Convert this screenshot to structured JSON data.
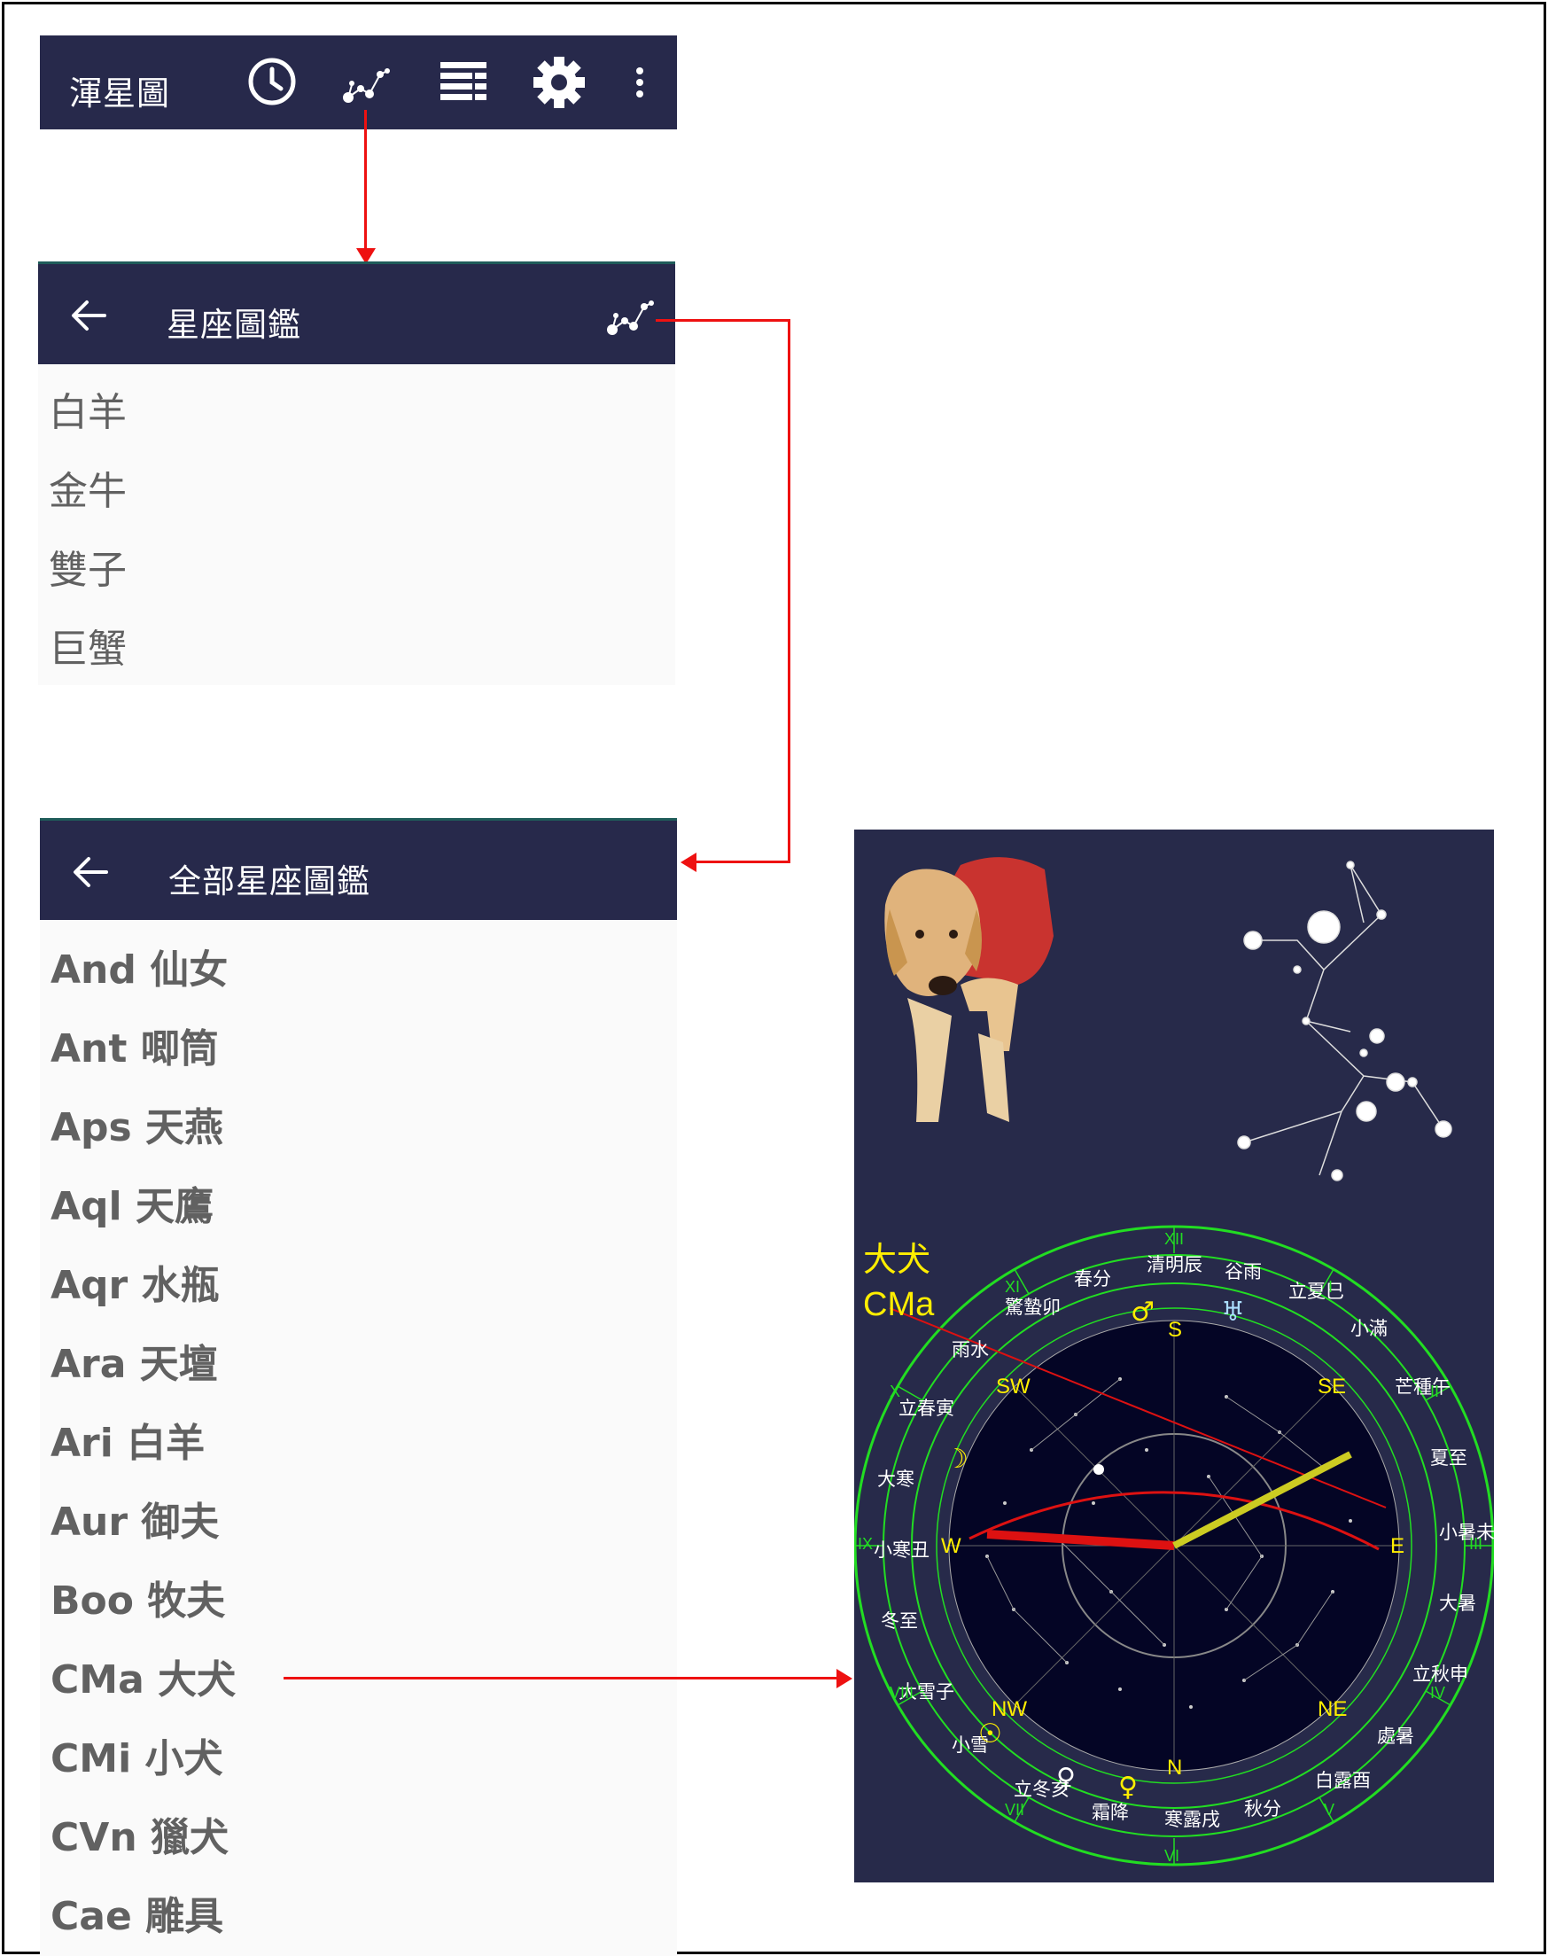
{
  "app_bar": {
    "title": "渾星圖",
    "icons": [
      "clock-icon",
      "constellation-icon",
      "list-icon",
      "gear-icon",
      "more-vert-icon"
    ]
  },
  "zodiac_screen": {
    "title": "星座圖鑑",
    "items": [
      "白羊",
      "金牛",
      "雙子",
      "巨蟹"
    ]
  },
  "all_screen": {
    "title": "全部星座圖鑑",
    "items": [
      "And 仙女",
      "Ant 唧筒",
      "Aps 天燕",
      "Aql 天鷹",
      "Aqr 水瓶",
      "Ara 天壇",
      "Ari 白羊",
      "Aur 御夫",
      "Boo 牧夫",
      "CMa 大犬",
      "CMi 小犬",
      "CVn 獵犬",
      "Cae 雕具"
    ]
  },
  "chart_view": {
    "label_zh": "大犬",
    "label_abbr": "CMa",
    "compass": [
      "S",
      "SW",
      "SE",
      "W",
      "E",
      "NW",
      "NE",
      "N"
    ],
    "solar_terms": [
      "春分",
      "清明辰",
      "谷雨",
      "立夏巳",
      "小滿",
      "芒種午",
      "夏至",
      "小暑未",
      "大暑",
      "立秋申",
      "處暑",
      "白露酉",
      "秋分",
      "寒露戌",
      "霜降",
      "立冬亥",
      "小雪",
      "大雪子",
      "冬至",
      "小寒丑",
      "大寒",
      "立春寅",
      "雨水",
      "驚蟄卯"
    ],
    "roman_hours": [
      "XII",
      "I",
      "II",
      "III",
      "IV",
      "V",
      "VI",
      "VII",
      "VIII",
      "IX",
      "X",
      "XI"
    ],
    "colors": {
      "bar": "#27294b",
      "panel": "#272a4a",
      "ring": "#22dd22",
      "label": "#ffee00",
      "arrow": "#ee1111"
    }
  }
}
